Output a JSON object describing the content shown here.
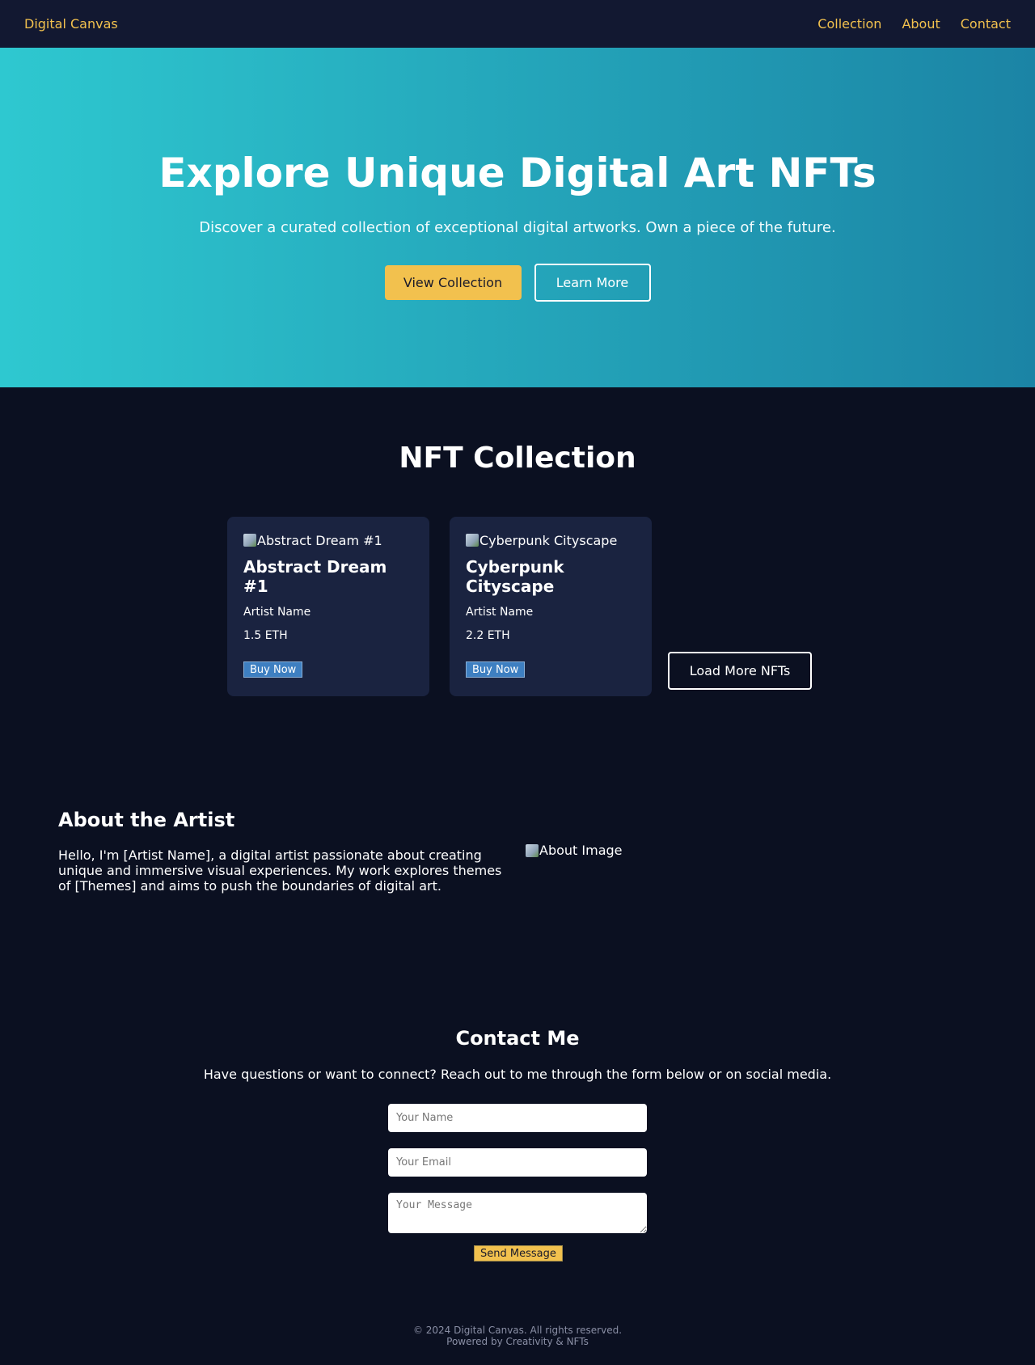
{
  "nav": {
    "brand": "Digital Canvas",
    "links": [
      "Collection",
      "About",
      "Contact"
    ]
  },
  "hero": {
    "title": "Explore Unique Digital Art NFTs",
    "subtitle": "Discover a curated collection of exceptional digital artworks. Own a piece of the future.",
    "primary_button": "View Collection",
    "secondary_button": "Learn More"
  },
  "collection": {
    "title": "NFT Collection",
    "items": [
      {
        "image_alt": "Abstract Dream #1",
        "title": "Abstract Dream #1",
        "artist": "Artist Name",
        "price": "1.5 ETH",
        "button": "Buy Now"
      },
      {
        "image_alt": "Cyberpunk Cityscape",
        "title": "Cyberpunk Cityscape",
        "artist": "Artist Name",
        "price": "2.2 ETH",
        "button": "Buy Now"
      }
    ],
    "load_more": "Load More NFTs"
  },
  "about": {
    "title": "About the Artist",
    "text": "Hello, I'm [Artist Name], a digital artist passionate about creating unique and immersive visual experiences. My work explores themes of [Themes] and aims to push the boundaries of digital art.",
    "image_alt": "About Image"
  },
  "contact": {
    "title": "Contact Me",
    "subtitle": "Have questions or want to connect? Reach out to me through the form below or on social media.",
    "name_placeholder": "Your Name",
    "email_placeholder": "Your Email",
    "message_placeholder": "Your Message",
    "send_button": "Send Message"
  },
  "footer": {
    "copyright": "© 2024 Digital Canvas. All rights reserved.",
    "powered": "Powered by Creativity & NFTs"
  },
  "colors": {
    "accent": "#f2c14e",
    "hero_gradient_start": "#2ec8d0",
    "hero_gradient_end": "#1b84a5",
    "background": "#0b1021",
    "card": "#1a2340",
    "buy_button": "#3e7fc1"
  }
}
